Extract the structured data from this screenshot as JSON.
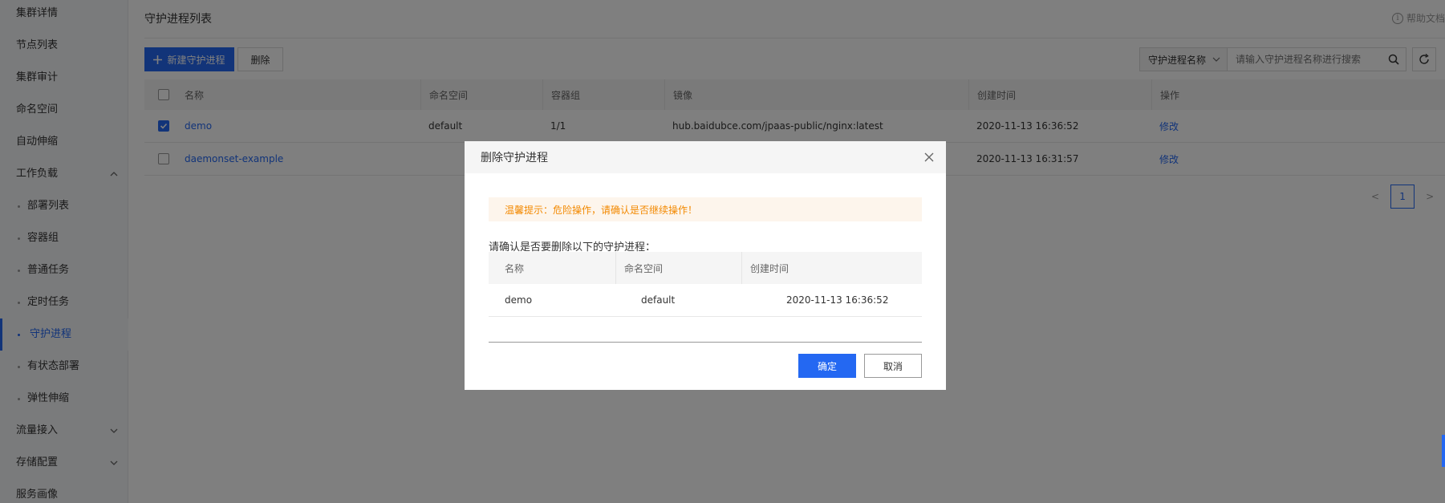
{
  "sidebar": {
    "items": [
      {
        "label": "集群详情"
      },
      {
        "label": "节点列表"
      },
      {
        "label": "集群审计"
      },
      {
        "label": "命名空间"
      },
      {
        "label": "自动伸缩"
      },
      {
        "label": "工作负载",
        "expanded": true
      },
      {
        "label": "部署列表"
      },
      {
        "label": "容器组"
      },
      {
        "label": "普通任务"
      },
      {
        "label": "定时任务"
      },
      {
        "label": "守护进程",
        "active": true
      },
      {
        "label": "有状态部署"
      },
      {
        "label": "弹性伸缩"
      },
      {
        "label": "流量接入"
      },
      {
        "label": "存储配置"
      },
      {
        "label": "服务画像"
      }
    ]
  },
  "header": {
    "title": "守护进程列表",
    "help_label": "帮助文档",
    "help_icon": "info-icon"
  },
  "toolbar": {
    "create_label": "新建守护进程",
    "delete_label": "删除"
  },
  "search": {
    "select_value": "守护进程名称",
    "placeholder": "请输入守护进程名称进行搜索",
    "search_icon": "search-icon",
    "refresh_icon": "refresh-icon"
  },
  "table": {
    "columns": [
      "名称",
      "命名空间",
      "容器组",
      "镜像",
      "创建时间",
      "操作"
    ],
    "rows": [
      {
        "checked": true,
        "name": "demo",
        "namespace": "default",
        "pods": "1/1",
        "image": "hub.baidubce.com/jpaas-public/nginx:latest",
        "created": "2020-11-13 16:36:52",
        "action": "修改"
      },
      {
        "checked": false,
        "name": "daemonset-example",
        "namespace": "",
        "pods": "",
        "image": "",
        "created": "2020-11-13 16:31:57",
        "action": "修改"
      }
    ]
  },
  "pagination": {
    "prev": "<",
    "current": "1",
    "next": ">"
  },
  "dialog": {
    "title": "删除守护进程",
    "warning": "温馨提示：危险操作，请确认是否继续操作！",
    "confirm_text": "请确认是否要删除以下的守护进程：",
    "columns": [
      "名称",
      "命名空间",
      "创建时间"
    ],
    "rows": [
      {
        "name": "demo",
        "namespace": "default",
        "created": "2020-11-13 16:36:52"
      }
    ],
    "ok_label": "确定",
    "cancel_label": "取消"
  },
  "colors": {
    "primary": "#2468f2",
    "warning_text": "#f38900",
    "warning_bg": "#fdf5ec"
  }
}
